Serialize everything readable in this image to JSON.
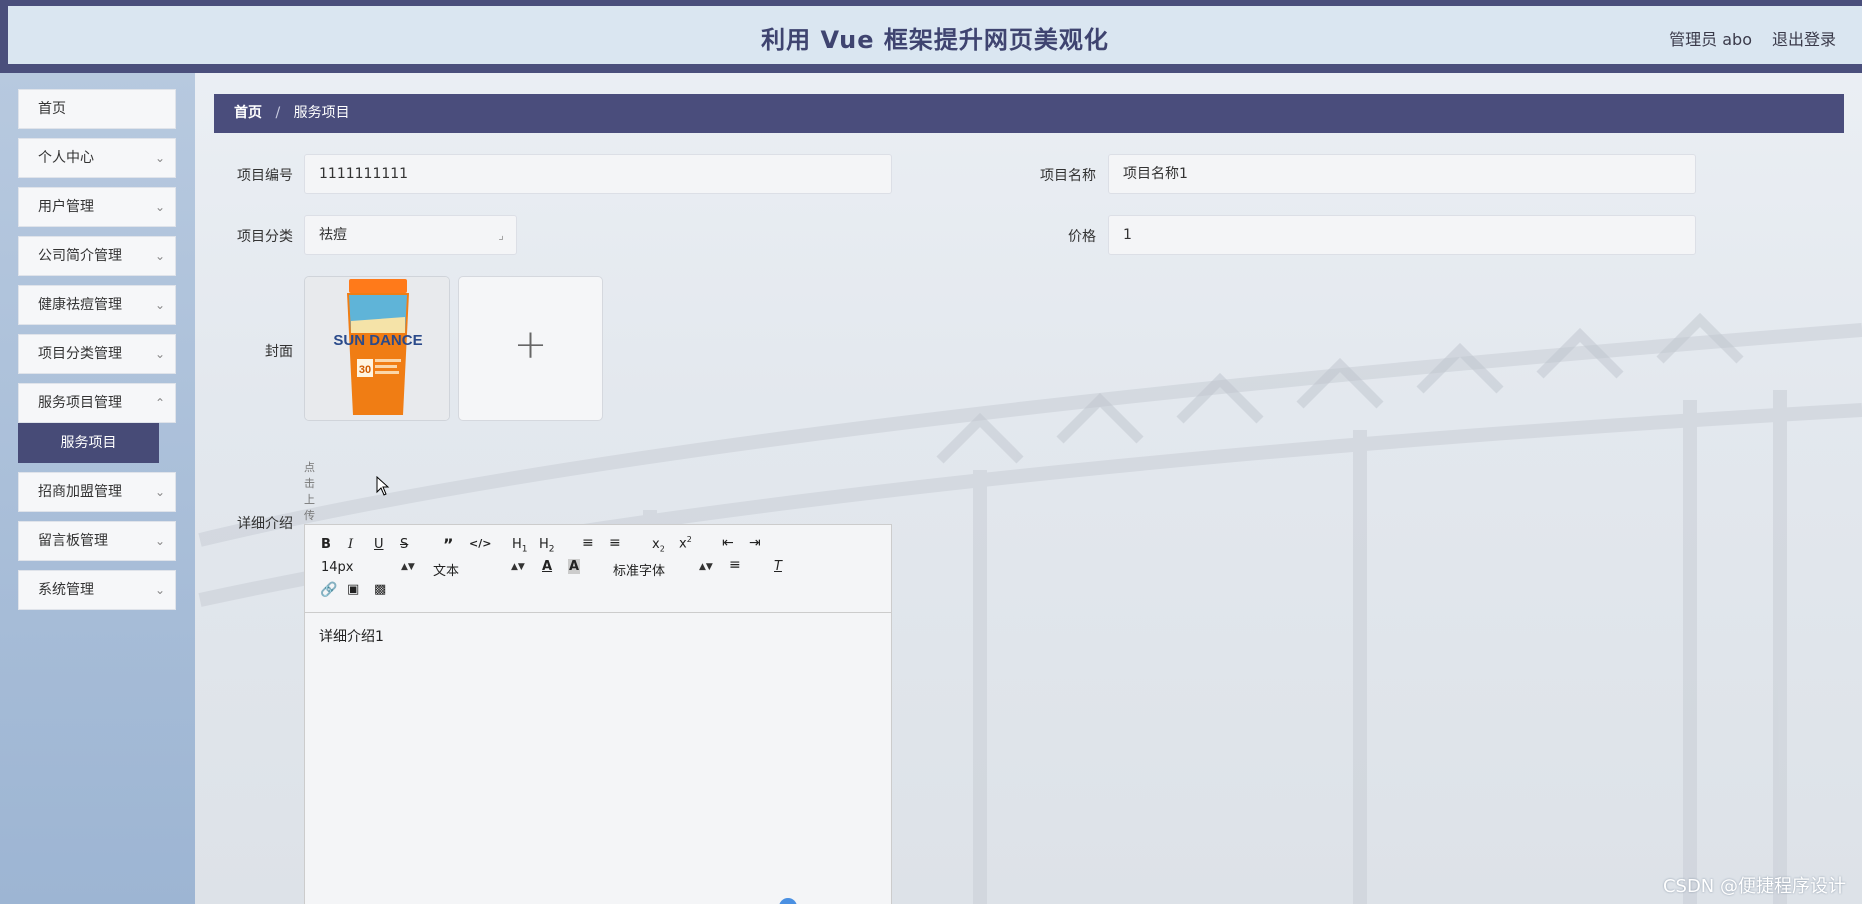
{
  "header": {
    "title": "利用 Vue 框架提升网页美观化",
    "user": "管理员 abo",
    "logout": "退出登录"
  },
  "sidebar": {
    "items": [
      {
        "label": "首页"
      },
      {
        "label": "个人中心"
      },
      {
        "label": "用户管理"
      },
      {
        "label": "公司简介管理"
      },
      {
        "label": "健康祛痘管理"
      },
      {
        "label": "项目分类管理"
      },
      {
        "label": "服务项目管理"
      },
      {
        "label": "招商加盟管理"
      },
      {
        "label": "留言板管理"
      },
      {
        "label": "系统管理"
      }
    ],
    "active_sub": "服务项目"
  },
  "breadcrumb": {
    "home": "首页",
    "separator": "/",
    "current": "服务项目"
  },
  "form": {
    "code_label": "项目编号",
    "code_value": "1111111111",
    "name_label": "项目名称",
    "name_value": "项目名称1",
    "category_label": "项目分类",
    "category_value": "祛痘",
    "price_label": "价格",
    "price_value": "1",
    "cover_label": "封面",
    "cover_image_text": "SUN DANCE",
    "cover_image_number": "30",
    "upload_hint": "点击上传封面",
    "detail_label": "详细介绍"
  },
  "editor": {
    "font_size": "14px",
    "text_type": "文本",
    "font_family": "标准字体",
    "content": "详细介绍1"
  },
  "watermark": "CSDN @便捷程序设计",
  "colors": {
    "header_bar": "#4a4f7c",
    "header_inner": "#dae6f1",
    "breadcrumb_bg": "#4a4d7c",
    "active_menu": "#474b77",
    "sidebar_bg": "#9db5d3"
  }
}
